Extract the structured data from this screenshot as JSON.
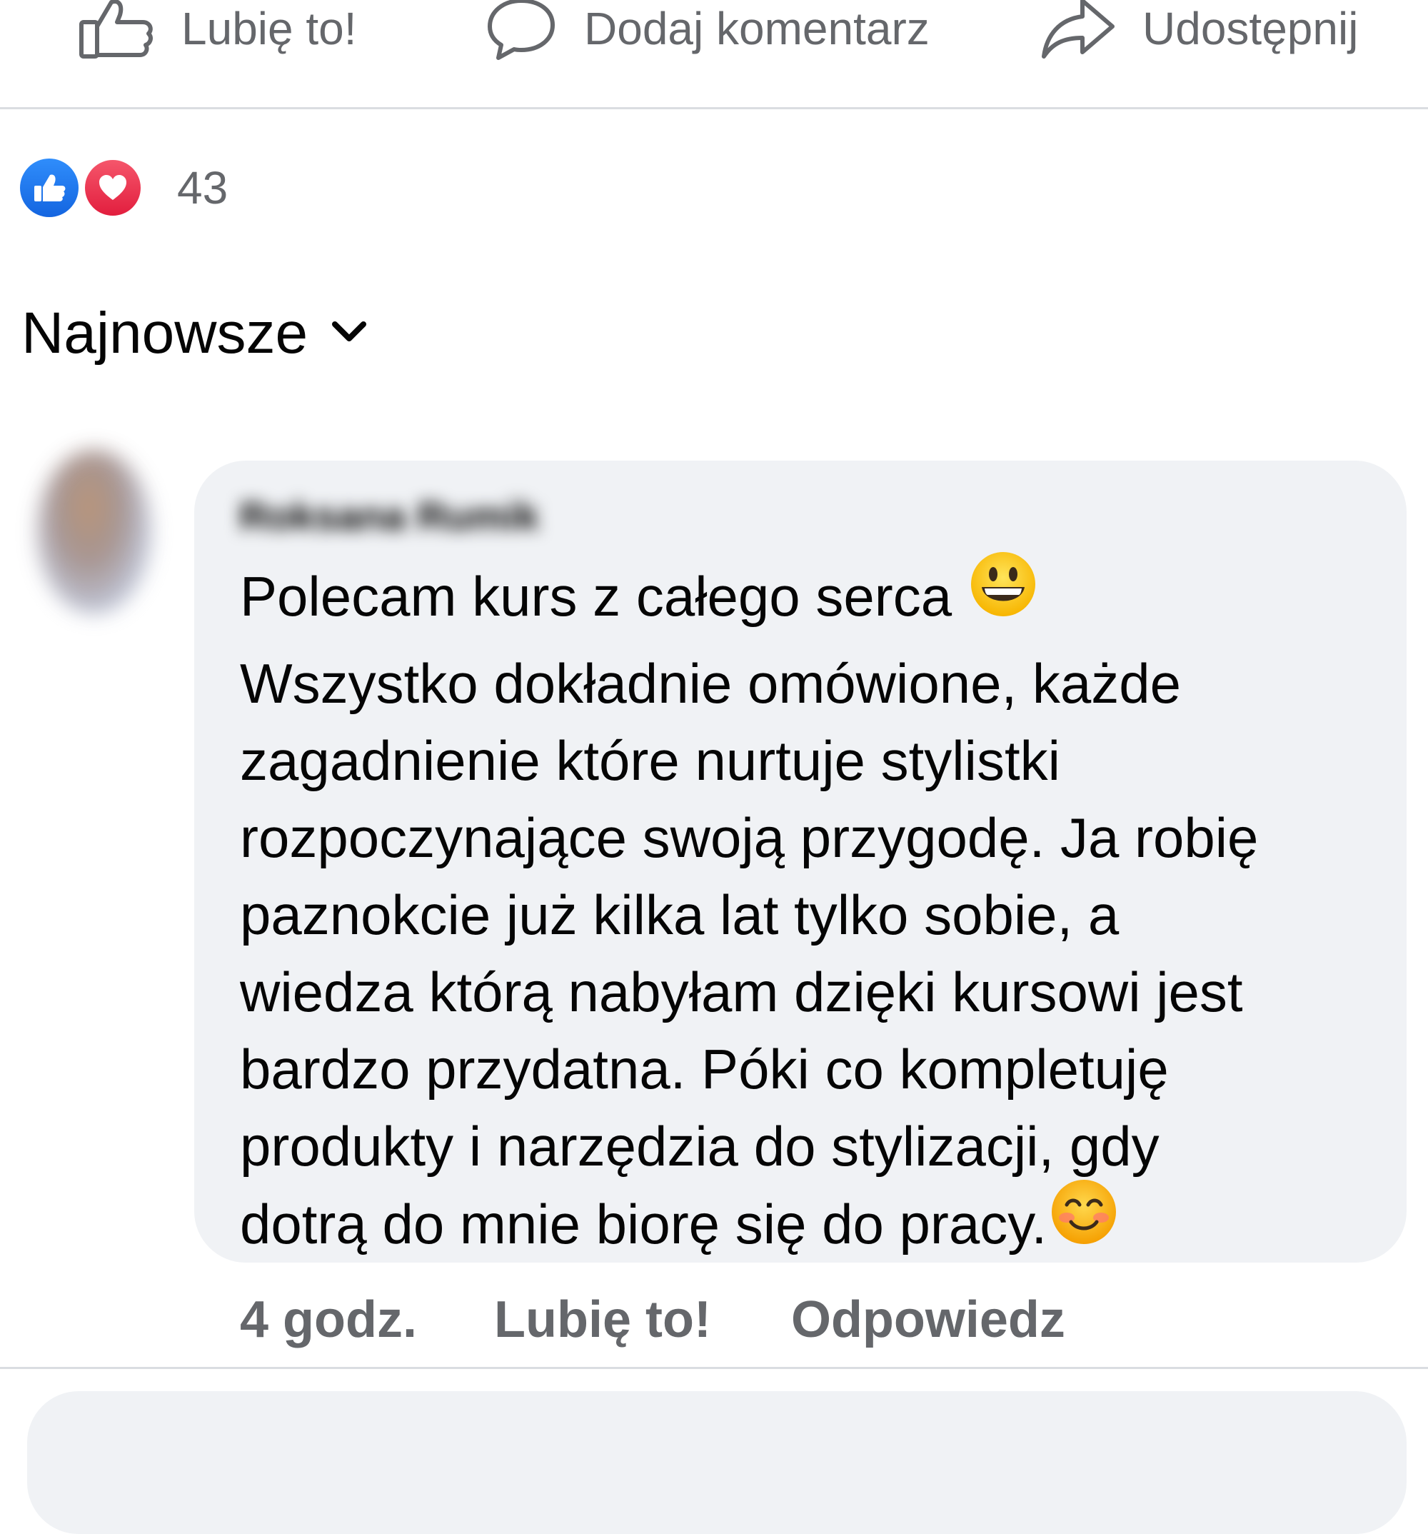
{
  "action_bar": {
    "like_label": "Lubię to!",
    "comment_label": "Dodaj komentarz",
    "share_label": "Udostępnij"
  },
  "reactions": {
    "count": "43",
    "types": [
      "like",
      "love"
    ]
  },
  "sort": {
    "label": "Najnowsze"
  },
  "comment": {
    "author": "Roksana Rumik",
    "lines": [
      "Polecam kurs z całego serca",
      "Wszystko dokładnie omówione, każde",
      "zagadnienie które nurtuje stylistki",
      "rozpoczynające swoją przygodę. Ja robię",
      "paznokcie już kilka lat tylko sobie, a",
      "wiedza którą nabyłam dzięki kursowi jest",
      "bardzo przydatna. Póki co kompletuję",
      "produkty i narzędzia do stylizacji, gdy",
      "dotrą do mnie biorę się do pracy."
    ],
    "emojis": [
      "grinning-face",
      "smiling-face-with-blushing"
    ],
    "time": "4 godz.",
    "like_label": "Lubię to!",
    "reply_label": "Odpowiedz"
  },
  "colors": {
    "secondary_text": "#65676b",
    "bubble_bg": "#f0f2f5",
    "like_blue": "#1877f2",
    "love_red": "#f33e58"
  }
}
